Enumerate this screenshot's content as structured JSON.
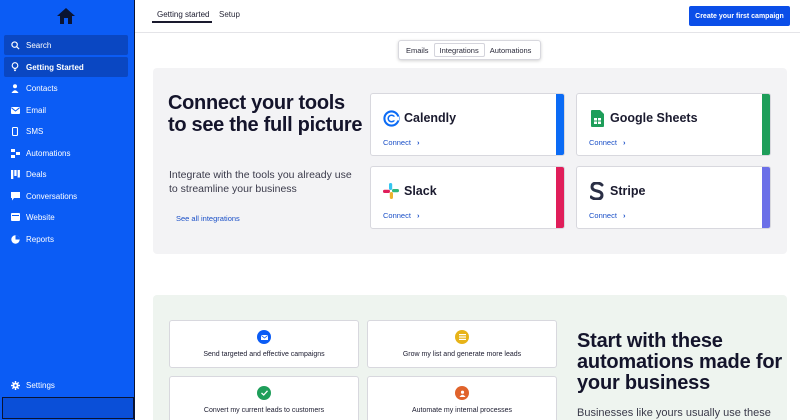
{
  "sidebar": {
    "items": [
      {
        "label": "Search",
        "icon": "search-icon"
      },
      {
        "label": "Getting Started",
        "icon": "lightbulb-icon"
      },
      {
        "label": "Contacts",
        "icon": "person-icon"
      },
      {
        "label": "Email",
        "icon": "envelope-icon"
      },
      {
        "label": "SMS",
        "icon": "phone-icon"
      },
      {
        "label": "Automations",
        "icon": "automations-icon"
      },
      {
        "label": "Deals",
        "icon": "deals-icon"
      },
      {
        "label": "Conversations",
        "icon": "chat-icon"
      },
      {
        "label": "Website",
        "icon": "website-icon"
      },
      {
        "label": "Reports",
        "icon": "pie-chart-icon"
      }
    ],
    "settings_label": "Settings",
    "active_item": "Getting Started"
  },
  "header": {
    "tabs": [
      {
        "label": "Getting started"
      },
      {
        "label": "Setup"
      }
    ],
    "cta_label": "Create your first campaign"
  },
  "segmented": {
    "options": [
      "Emails",
      "Integrations",
      "Automations"
    ],
    "selected": "Integrations"
  },
  "integrations": {
    "headline": "Connect your tools to see the full picture",
    "subtext": "Integrate with the tools you already use to streamline your business",
    "see_all_label": "See all integrations",
    "cards": [
      {
        "name": "Calendly",
        "connect_label": "Connect",
        "accent": "#0b6bf5",
        "icon": "calendly-logo"
      },
      {
        "name": "Google Sheets",
        "connect_label": "Connect",
        "accent": "#1e9e5a",
        "icon": "google-sheets-logo"
      },
      {
        "name": "Slack",
        "connect_label": "Connect",
        "accent": "#e01e5a",
        "icon": "slack-logo"
      },
      {
        "name": "Stripe",
        "connect_label": "Connect",
        "accent": "#6b6fe8",
        "icon": "stripe-logo"
      }
    ]
  },
  "automations": {
    "cards": [
      {
        "label": "Send targeted and effective campaigns",
        "icon": "envelope-icon",
        "color": "#0b5cf5"
      },
      {
        "label": "Grow my list and generate more leads",
        "icon": "list-icon",
        "color": "#e7b318"
      },
      {
        "label": "Convert my current leads to customers",
        "icon": "check-icon",
        "color": "#1e9e5a"
      },
      {
        "label": "Automate my internal processes",
        "icon": "gear-person-icon",
        "color": "#e0632b"
      }
    ],
    "headline": "Start with these automations made for your business",
    "subtext": "Businesses like yours usually use these"
  },
  "colors": {
    "sidebar_bg": "#0b5cf5",
    "cta_bg": "#0b4ee8",
    "link": "#1a4fc7"
  }
}
